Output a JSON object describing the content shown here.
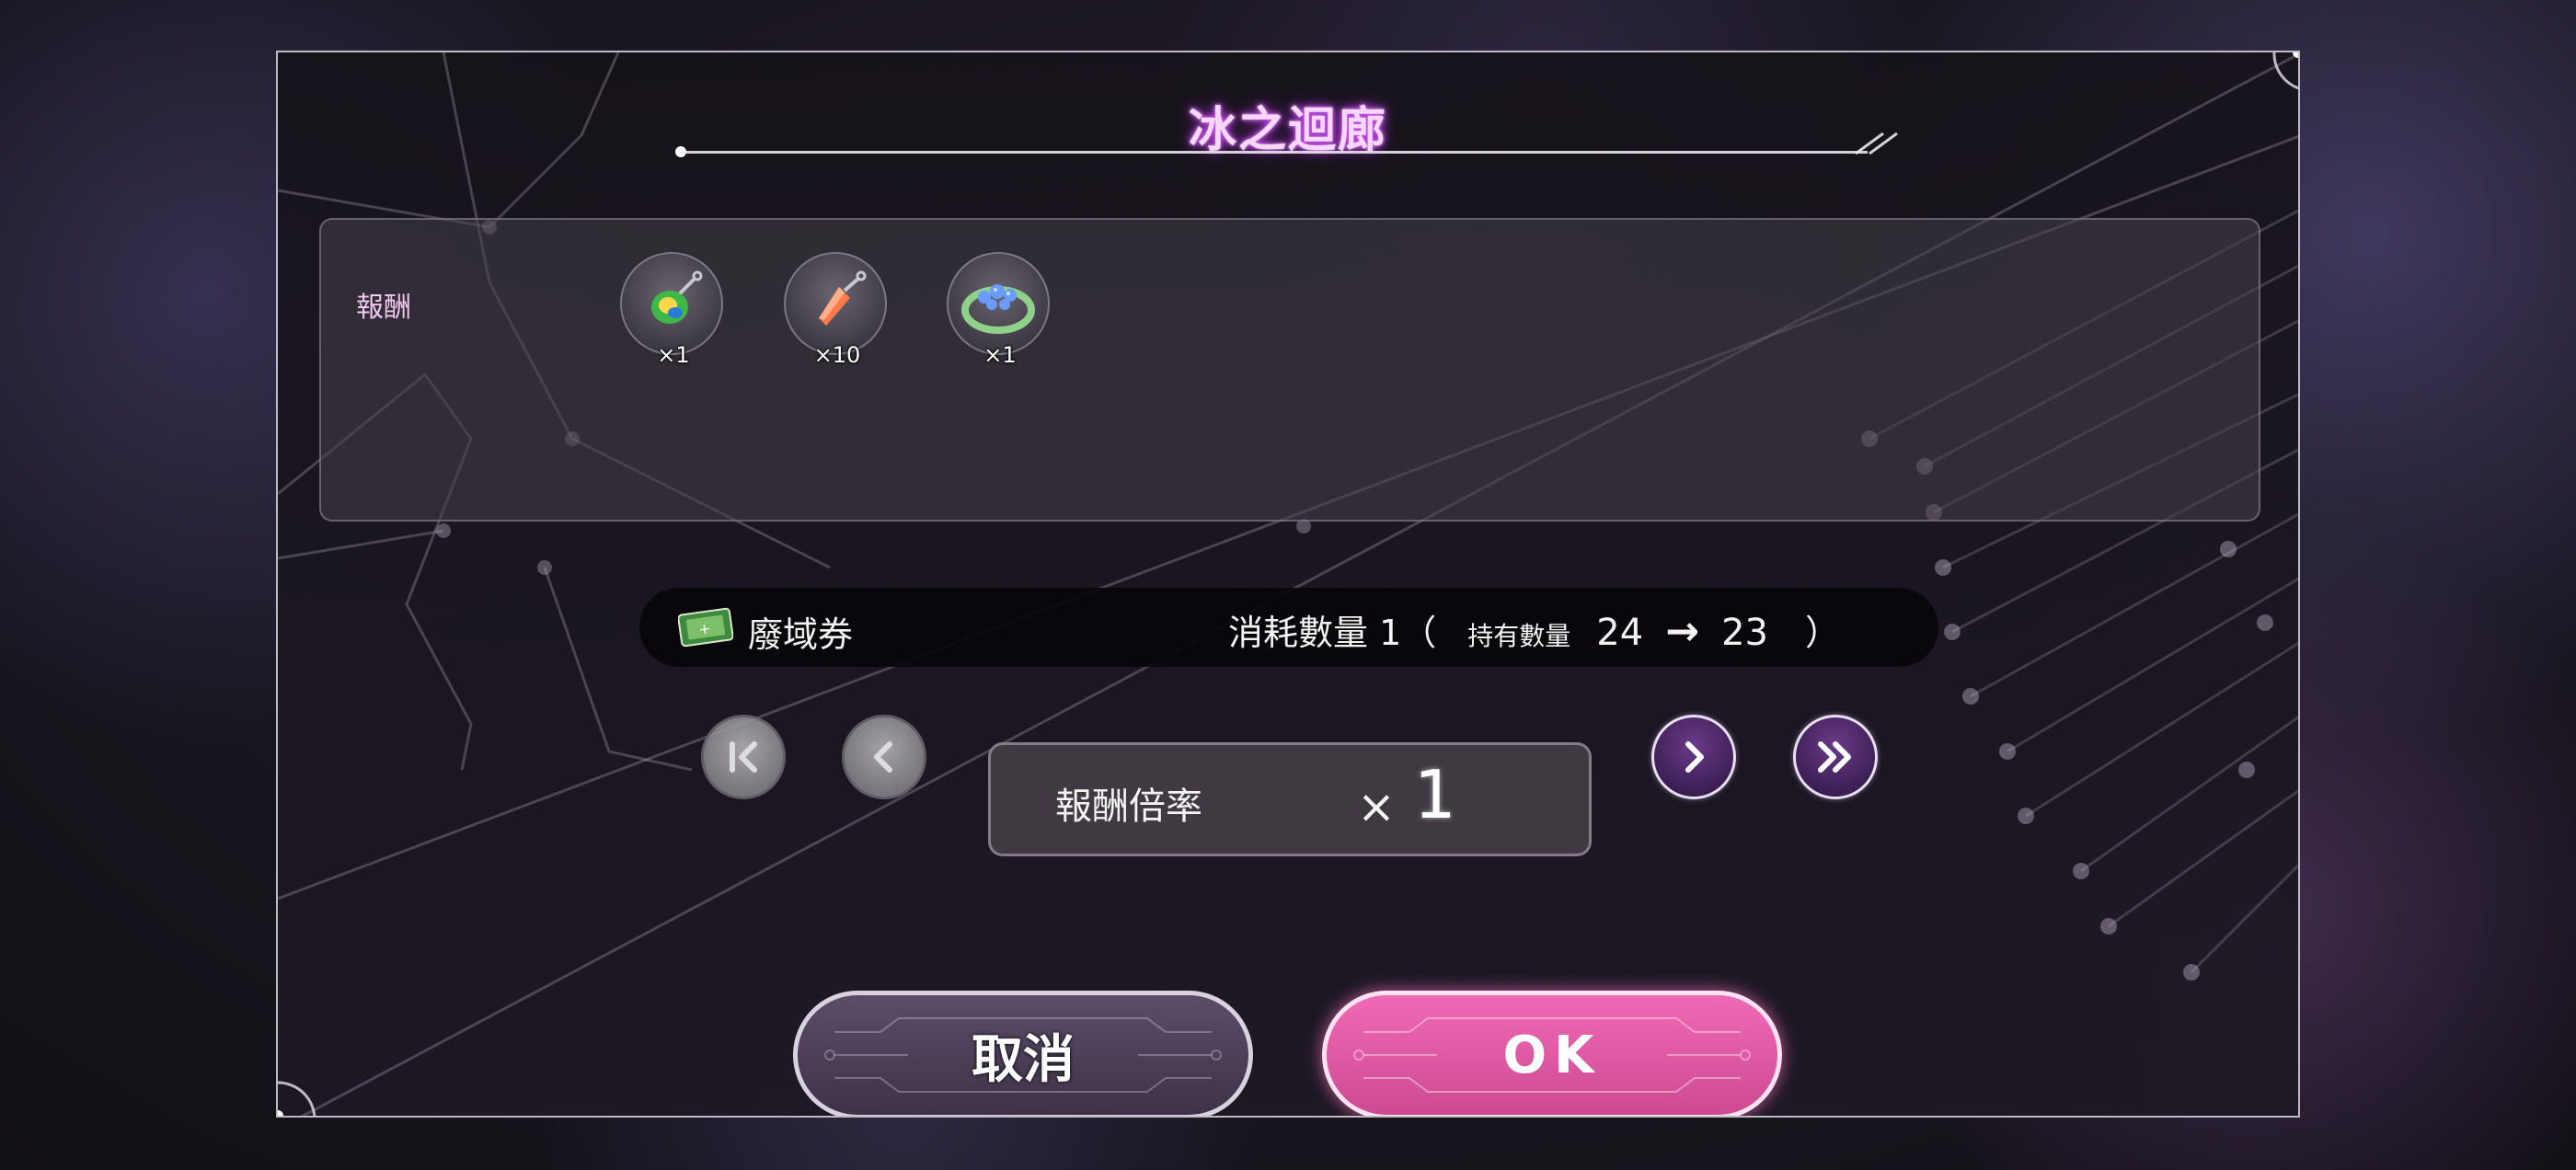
{
  "dialog": {
    "title": "冰之迴廊"
  },
  "rewards": {
    "label": "報酬",
    "items": [
      {
        "icon": "green-crystal-pendant-icon",
        "count": "×1"
      },
      {
        "icon": "orange-crystal-icon",
        "count": "×10"
      },
      {
        "icon": "blue-gem-ring-icon",
        "count": "×1"
      }
    ]
  },
  "ticket": {
    "icon": "green-ticket-icon",
    "name": "廢域券",
    "consume_label": "消耗數量 1（",
    "owned_label": "持有數量",
    "owned_before": "24",
    "arrow": "→",
    "owned_after": "23",
    "close_paren": "）"
  },
  "multiplier": {
    "label": "報酬倍率",
    "x": "×",
    "value": "1"
  },
  "controls": {
    "first_icon": "skip-to-first-icon",
    "prev_icon": "chevron-left-icon",
    "next_icon": "chevron-right-icon",
    "last_icon": "double-chevron-right-icon"
  },
  "buttons": {
    "cancel": "取消",
    "ok": "OK"
  },
  "colors": {
    "title_glow": "#d04ef0",
    "ok_pink": "#e65aa6",
    "cancel_purple": "#4a3d58"
  }
}
